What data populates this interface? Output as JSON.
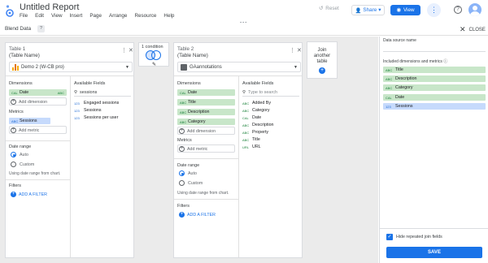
{
  "header": {
    "title": "Untitled Report",
    "menu": [
      "File",
      "Edit",
      "View",
      "Insert",
      "Page",
      "Arrange",
      "Resource",
      "Help"
    ],
    "reset_label": "Reset",
    "share_label": "Share",
    "view_label": "View"
  },
  "blend": {
    "title": "Blend Data",
    "help": "?",
    "close_label": "CLOSE"
  },
  "table1": {
    "table_label": "Table 1",
    "table_name": "(Table Name)",
    "source": "Demo 2 (W-CB pro)",
    "dimensions_label": "Dimensions",
    "dimensions": [
      {
        "tag": "CAL",
        "name": "Date",
        "extra": "ABC"
      }
    ],
    "add_dimension": "Add dimension",
    "metrics_label": "Metrics",
    "metrics": [
      {
        "tag": "ABC",
        "name": "Sessions"
      }
    ],
    "add_metric": "Add metric",
    "date_range_label": "Date range",
    "date_auto": "Auto",
    "date_custom": "Custom",
    "date_hint": "Using date range from chart.",
    "filters_label": "Filters",
    "add_filter": "ADD A FILTER",
    "available_title": "Available Fields",
    "search_value": "sessions",
    "fields": [
      {
        "tag": "123",
        "name": "Engaged sessions"
      },
      {
        "tag": "123",
        "name": "Sessions"
      },
      {
        "tag": "123",
        "name": "Sessions per user"
      }
    ]
  },
  "condition": {
    "label": "1 condition"
  },
  "table2": {
    "table_label": "Table 2",
    "table_name": "(Table Name)",
    "source": "GAannotations",
    "dimensions_label": "Dimensions",
    "dimensions": [
      {
        "tag": "CAL",
        "name": "Date"
      },
      {
        "tag": "ABC",
        "name": "Title"
      },
      {
        "tag": "ABC",
        "name": "Description"
      },
      {
        "tag": "ABC",
        "name": "Category"
      }
    ],
    "add_dimension": "Add dimension",
    "metrics_label": "Metrics",
    "add_metric": "Add metric",
    "date_range_label": "Date range",
    "date_auto": "Auto",
    "date_custom": "Custom",
    "date_hint": "Using date range from chart.",
    "filters_label": "Filters",
    "add_filter": "ADD A FILTER",
    "available_title": "Available Fields",
    "search_placeholder": "Type to search",
    "fields": [
      {
        "tag": "ABC",
        "type": "d",
        "name": "Added By"
      },
      {
        "tag": "ABC",
        "type": "d",
        "name": "Category"
      },
      {
        "tag": "CAL",
        "type": "d",
        "name": "Date"
      },
      {
        "tag": "ABC",
        "type": "d",
        "name": "Description"
      },
      {
        "tag": "ABC",
        "type": "d",
        "name": "Property"
      },
      {
        "tag": "ABC",
        "type": "d",
        "name": "Title"
      },
      {
        "tag": "URL",
        "type": "d",
        "name": "URL"
      }
    ]
  },
  "join_box": {
    "label_line1": "Join",
    "label_line2": "another",
    "label_line3": "table"
  },
  "right_panel": {
    "source_name_label": "Data source name",
    "included_label": "Included dimensions and metrics",
    "included": [
      {
        "tag": "ABC",
        "name": "Title",
        "kind": "dim"
      },
      {
        "tag": "ABC",
        "name": "Description",
        "kind": "dim"
      },
      {
        "tag": "ABC",
        "name": "Category",
        "kind": "dim"
      },
      {
        "tag": "CAL",
        "name": "Date",
        "kind": "dim"
      },
      {
        "tag": "123",
        "name": "Sessions",
        "kind": "met"
      }
    ],
    "hide_repeated_label": "Hide repeated join fields",
    "save_label": "SAVE"
  },
  "colors": {
    "accent": "#1a73e8",
    "dimension": "#c8e6c9",
    "metric": "#c6dafc",
    "canvas": "#ebebeb"
  }
}
